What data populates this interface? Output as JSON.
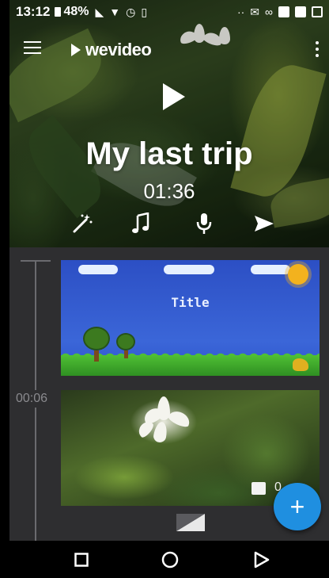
{
  "status_bar": {
    "time": "13:12",
    "battery": "48%"
  },
  "app": {
    "logo_text": "wevideo"
  },
  "project": {
    "title": "My last trip",
    "duration": "01:36"
  },
  "timeline": {
    "time_marker": "00:06",
    "clips": [
      {
        "type": "title",
        "title_text": "Title"
      },
      {
        "type": "photo",
        "label": "0"
      }
    ]
  },
  "fab": {
    "label": "+"
  },
  "colors": {
    "accent": "#1f8fe0",
    "timeline_bg": "#2e2e30",
    "nav_bg": "#000000"
  },
  "icons": {
    "hero_tools": [
      "magic-wand-icon",
      "music-note-icon",
      "microphone-icon",
      "send-icon"
    ],
    "nav": [
      "recents-icon",
      "home-icon",
      "back-icon"
    ]
  }
}
